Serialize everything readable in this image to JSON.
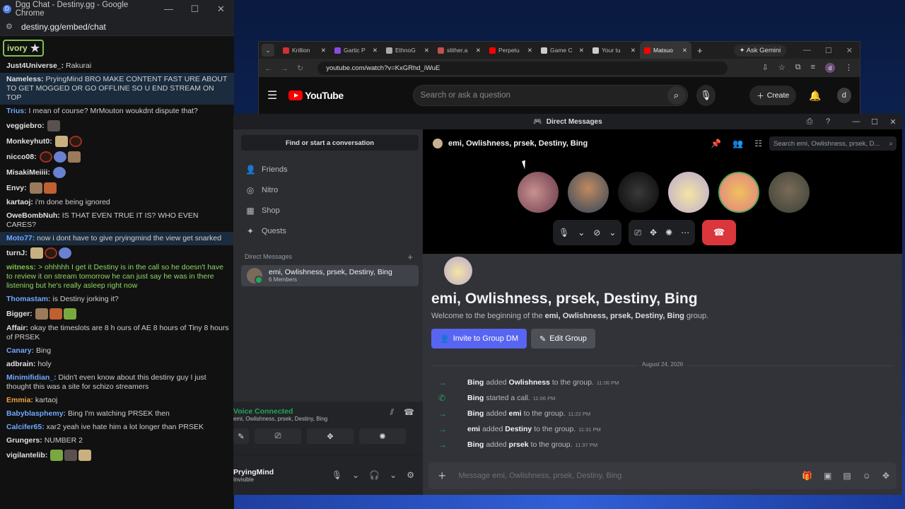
{
  "chat_window": {
    "title": "Dgg Chat - Destiny.gg - Google Chrome",
    "url": "destiny.gg/embed/chat",
    "flair_label": "ivory",
    "messages": [
      {
        "user": "Just4Universe_:",
        "text": "Rakurai",
        "style": ""
      },
      {
        "user": "Nameless:",
        "text": "PryingMind BRO MAKE CONTENT FAST URE ABOUT TO GET MOGGED OR GO OFFLINE SO U END STREAM ON TOP",
        "style": "hl"
      },
      {
        "user": "Trius:",
        "text": "I mean of course? MrMouton woukdnt dispute that?",
        "style": ""
      },
      {
        "user": "veggiebro:",
        "text": "",
        "style": ""
      },
      {
        "user": "Monkeyhut0:",
        "text": "",
        "style": ""
      },
      {
        "user": "nicco08:",
        "text": "",
        "style": ""
      },
      {
        "user": "MisakiMeiiii:",
        "text": "",
        "style": ""
      },
      {
        "user": "Envy:",
        "text": "",
        "style": ""
      },
      {
        "user": "kartaoj:",
        "text": "i'm done being ignored",
        "style": ""
      },
      {
        "user": "OweBombNuh:",
        "text": "IS THAT EVEN TRUE IT IS? WHO EVEN CARES?",
        "style": ""
      },
      {
        "user": "Moto77:",
        "text": "now i dont have to give pryingmind the view get snarked",
        "style": "hl"
      },
      {
        "user": "turnJ:",
        "text": "",
        "style": ""
      },
      {
        "user": "witness:",
        "text": "> ohhhhh I get it Destiny is in the call so he doesn't have to review it on stream tomorrow he can just say he was in there listening but he's really asleep right now",
        "style": "green"
      },
      {
        "user": "Thomastam:",
        "text": "is Destiny jorking it?",
        "style": ""
      },
      {
        "user": "Bigger:",
        "text": "",
        "style": ""
      },
      {
        "user": "Affair:",
        "text": "okay the timeslots are 8 h ours of AE 8 hours of Tiny 8 hours of PRSEK",
        "style": ""
      },
      {
        "user": "Canary:",
        "text": "Bing",
        "style": ""
      },
      {
        "user": "adbrain:",
        "text": "holy",
        "style": ""
      },
      {
        "user": "Minimifidian_:",
        "text": "Didn't even know about this destiny guy I just thought this was a site for schizo streamers",
        "style": ""
      },
      {
        "user": "Emmia:",
        "text": "kartaoj",
        "style": ""
      },
      {
        "user": "Babyblasphemy:",
        "text": "Bing I'm watching PRSEK then",
        "style": ""
      },
      {
        "user": "Calcifer65:",
        "text": "xar2 yeah ive hate him a lot longer than PRSEK",
        "style": ""
      },
      {
        "user": "Grungers:",
        "text": "NUMBER 2",
        "style": ""
      },
      {
        "user": "vigilantelib:",
        "text": "",
        "style": ""
      }
    ]
  },
  "youtube_window": {
    "tabs": [
      {
        "label": "Krillion",
        "color": "#d0303a"
      },
      {
        "label": "Gartic P",
        "color": "#8a4ae0"
      },
      {
        "label": "EthnoG",
        "color": "#aaaaaa"
      },
      {
        "label": "slither.a",
        "color": "#c05050"
      },
      {
        "label": "Perpetu",
        "color": "#ff0000"
      },
      {
        "label": "Game C",
        "color": "#cccccc"
      },
      {
        "label": "Your tu",
        "color": "#cccccc"
      },
      {
        "label": "Matsuo",
        "color": "#ff0000"
      }
    ],
    "ask_gemini": "Ask Gemini",
    "url": "youtube.com/watch?v=KxGRhd_iWuE",
    "logo_text": "YouTube",
    "search_placeholder": "Search or ask a question",
    "create_label": "Create",
    "avatar_letter": "d",
    "profile_letter": "d"
  },
  "discord": {
    "window_title": "Direct Messages",
    "find_placeholder": "Find or start a conversation",
    "nav": [
      {
        "label": "Friends",
        "icon": "friends-icon",
        "glyph": "👤"
      },
      {
        "label": "Nitro",
        "icon": "nitro-icon",
        "glyph": "◎"
      },
      {
        "label": "Shop",
        "icon": "shop-icon",
        "glyph": "▦"
      },
      {
        "label": "Quests",
        "icon": "quests-icon",
        "glyph": "✦"
      }
    ],
    "dm_header": "Direct Messages",
    "dm_item": {
      "name": "emi, Owlishness, prsek, Destiny, Bing",
      "members": "6 Members"
    },
    "voice": {
      "title": "Voice Connected",
      "subtitle": "emi, Owlishness, prsek, Destiny, Bing"
    },
    "user": {
      "name": "PryingMind",
      "status": "Invisible"
    },
    "call_title": "emi, Owlishness, prsek, Destiny, Bing",
    "header_search_placeholder": "Search emi, Owlishness, prsek, D...",
    "big_title": "emi, Owlishness, prsek, Destiny, Bing",
    "welcome_prefix": "Welcome to the beginning of the",
    "welcome_group": "emi, Owlishness, prsek, Destiny, Bing",
    "welcome_suffix": "group.",
    "invite_label": "Invite to Group DM",
    "edit_label": "Edit Group",
    "date_divider": "August 24, 2026",
    "system_messages": [
      {
        "icon": "→",
        "who": "Bing",
        "pre": "added",
        "target": "Owlishness",
        "post": "to the group.",
        "time": "11:06 PM"
      },
      {
        "icon": "✆",
        "who": "Bing",
        "pre": "started a call.",
        "target": "",
        "post": "",
        "time": "11:06 PM"
      },
      {
        "icon": "→",
        "who": "Bing",
        "pre": "added",
        "target": "emi",
        "post": "to the group.",
        "time": "11:22 PM"
      },
      {
        "icon": "→",
        "who": "emi",
        "pre": "added",
        "target": "Destiny",
        "post": "to the group.",
        "time": "11:31 PM"
      },
      {
        "icon": "→",
        "who": "Bing",
        "pre": "added",
        "target": "prsek",
        "post": "to the group.",
        "time": "11:37 PM"
      }
    ],
    "message_placeholder": "Message emi, Owlishness, prsek, Destiny, Bing",
    "colors": {
      "accent": "#5865f2",
      "online": "#23a55a",
      "hangup": "#da373c"
    }
  }
}
